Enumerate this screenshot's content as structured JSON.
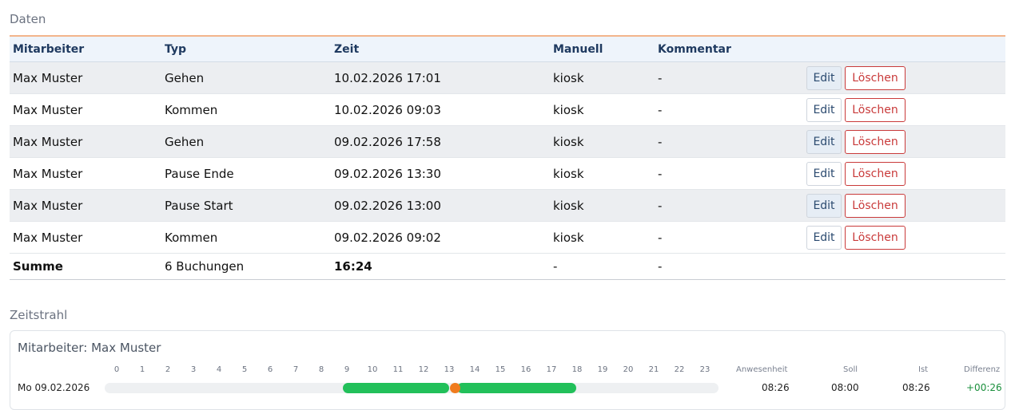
{
  "sections": {
    "data_title": "Daten",
    "timeline_title": "Zeitstrahl"
  },
  "table": {
    "headers": [
      "Mitarbeiter",
      "Typ",
      "Zeit",
      "Manuell",
      "Kommentar"
    ],
    "edit_label": "Edit",
    "delete_label": "Löschen",
    "rows": [
      {
        "employee": "Max Muster",
        "type": "Gehen",
        "time": "10.02.2026 17:01",
        "manual": "kiosk",
        "comment": "-"
      },
      {
        "employee": "Max Muster",
        "type": "Kommen",
        "time": "10.02.2026 09:03",
        "manual": "kiosk",
        "comment": "-"
      },
      {
        "employee": "Max Muster",
        "type": "Gehen",
        "time": "09.02.2026 17:58",
        "manual": "kiosk",
        "comment": "-"
      },
      {
        "employee": "Max Muster",
        "type": "Pause Ende",
        "time": "09.02.2026 13:30",
        "manual": "kiosk",
        "comment": "-"
      },
      {
        "employee": "Max Muster",
        "type": "Pause Start",
        "time": "09.02.2026 13:00",
        "manual": "kiosk",
        "comment": "-"
      },
      {
        "employee": "Max Muster",
        "type": "Kommen",
        "time": "09.02.2026 09:02",
        "manual": "kiosk",
        "comment": "-"
      }
    ],
    "summary": {
      "label": "Summe",
      "count": "6 Buchungen",
      "total": "16:24",
      "manual": "-",
      "comment": "-"
    }
  },
  "timeline": {
    "employee_label": "Mitarbeiter: Max Muster",
    "hours": [
      "0",
      "1",
      "2",
      "3",
      "4",
      "5",
      "6",
      "7",
      "8",
      "9",
      "10",
      "11",
      "12",
      "13",
      "14",
      "15",
      "16",
      "17",
      "18",
      "19",
      "20",
      "21",
      "22",
      "23"
    ],
    "stat_headers": {
      "presence": "Anwesenheit",
      "target": "Soll",
      "actual": "Ist",
      "difference": "Differenz"
    },
    "days": [
      {
        "label": "Mo 09.02.2026",
        "presence": "08:26",
        "target": "08:00",
        "actual": "08:26",
        "difference": "+00:26",
        "work_segments": [
          [
            9.03,
            13.0
          ],
          [
            13.5,
            17.97
          ]
        ],
        "pause_marker_hour": 13.25
      }
    ],
    "colors": {
      "work": "#22c05a",
      "pause": "#f07c1e",
      "difference_positive": "#1a8f3c"
    }
  }
}
